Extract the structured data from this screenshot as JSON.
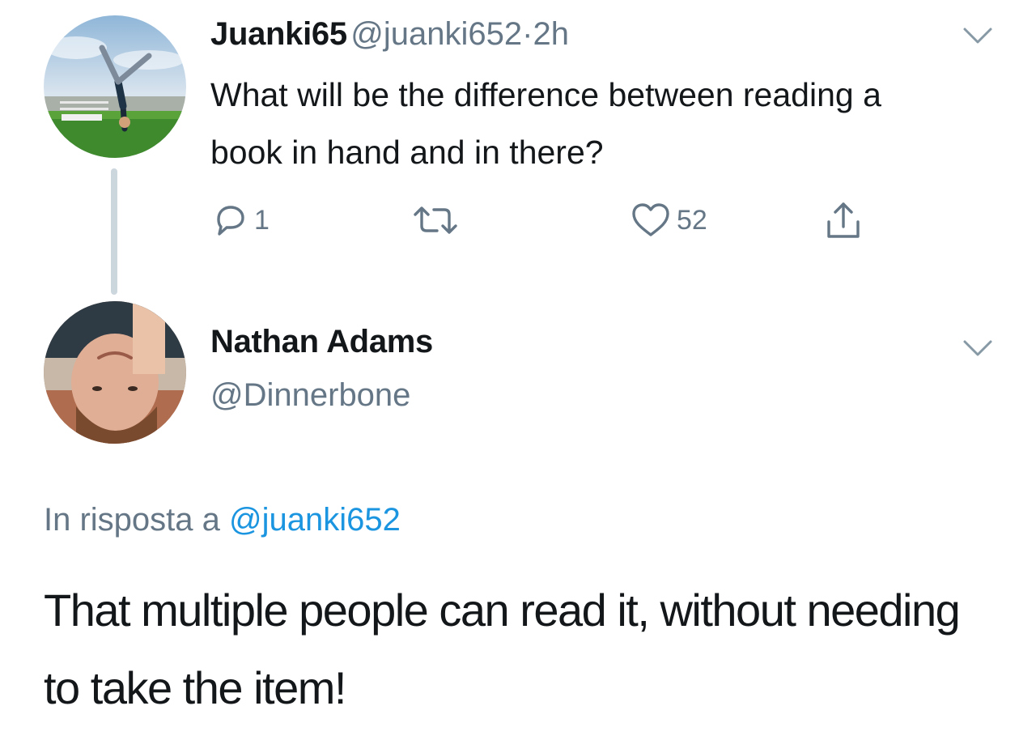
{
  "parent_tweet": {
    "display_name": "Juanki65",
    "handle": "@juanki652",
    "separator": "·",
    "time": "2h",
    "text": "What will be the difference between reading a book in hand and in there?",
    "actions": {
      "reply_count": "1",
      "retweet_count": "",
      "like_count": "52"
    },
    "avatar_icon": "person-handstand-avatar"
  },
  "reply_tweet": {
    "display_name": "Nathan Adams",
    "handle": "@Dinnerbone",
    "reply_context_prefix": "In risposta a",
    "reply_context_mention": "@juanki652",
    "text": "That multiple people can read it, without needing to take the item!",
    "avatar_icon": "upside-down-face-avatar"
  },
  "icons": {
    "reply": "speech-bubble-icon",
    "retweet": "retweet-arrows-icon",
    "like": "heart-icon",
    "share": "share-upload-icon",
    "menu": "chevron-down-icon"
  },
  "colors": {
    "text_primary": "#14171a",
    "text_secondary": "#657786",
    "link": "#1b95e0",
    "thread_line": "#ccd6dd"
  }
}
